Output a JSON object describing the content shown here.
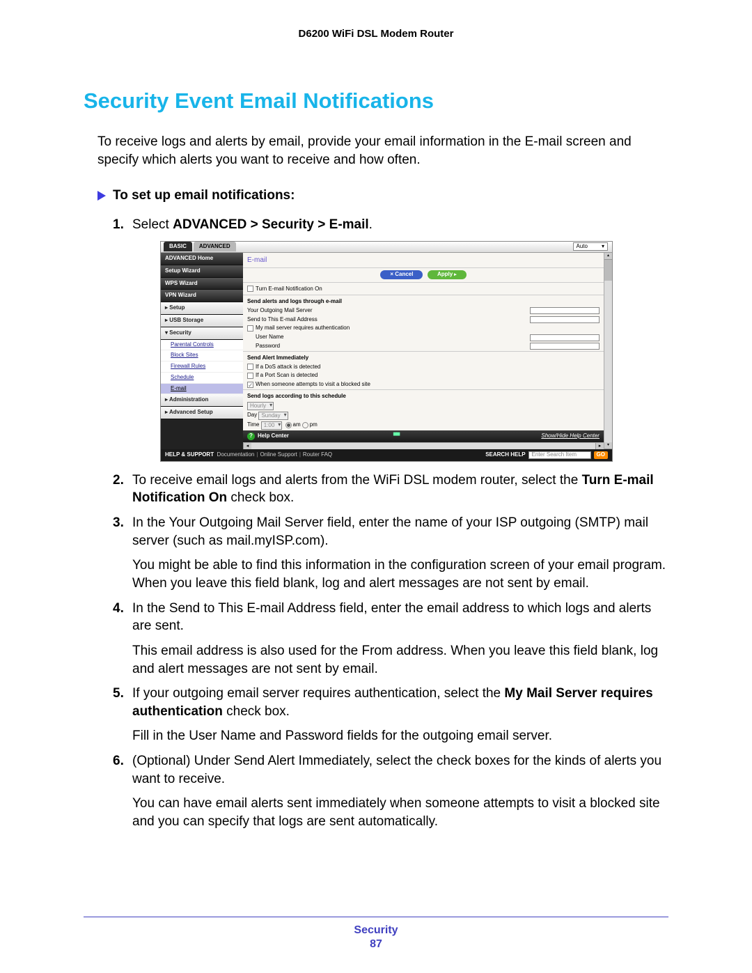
{
  "header": {
    "model": "D6200 WiFi DSL Modem Router"
  },
  "title": "Security Event Email Notifications",
  "intro": "To receive logs and alerts by email, provide your email information in the E-mail screen and specify which alerts you want to receive and how often.",
  "subhead": "To set up email notifications:",
  "steps": {
    "s1_prefix": "Select ",
    "s1_bold": "ADVANCED > Security > E-mail",
    "s1_suffix": ".",
    "s2a": "To receive email logs and alerts from the WiFi DSL modem router, select the ",
    "s2b": "Turn E-mail Notification On",
    "s2c": " check box.",
    "s3": "In the Your Outgoing Mail Server field, enter the name of your ISP outgoing (SMTP) mail server (such as mail.myISP.com).",
    "s3p": "You might be able to find this information in the configuration screen of your email program. When you leave this field blank, log and alert messages are not sent by email.",
    "s4": "In the Send to This E-mail Address field, enter the email address to which logs and alerts are sent.",
    "s4p": "This email address is also used for the From address. When you leave this field blank, log and alert messages are not sent by email.",
    "s5a": "If your outgoing email server requires authentication, select the ",
    "s5b": "My Mail Server requires authentication",
    "s5c": " check box.",
    "s5p": "Fill in the User Name and Password fields for the outgoing email server.",
    "s6": "(Optional) Under Send Alert Immediately, select the check boxes for the kinds of alerts you want to receive.",
    "s6p": "You can have email alerts sent immediately when someone attempts to visit a blocked site and you can specify that logs are sent automatically."
  },
  "shot": {
    "tabs": {
      "basic": "BASIC",
      "advanced": "ADVANCED",
      "auto": "Auto"
    },
    "sidebar": {
      "home": "ADVANCED Home",
      "setup_wizard": "Setup Wizard",
      "wps_wizard": "WPS Wizard",
      "vpn_wizard": "VPN Wizard",
      "setup": "▸ Setup",
      "usb": "▸ USB Storage",
      "security": "▾ Security",
      "sub": {
        "parental": "Parental Controls",
        "block_sites": "Block Sites",
        "firewall": "Firewall Rules",
        "schedule": "Schedule",
        "email": "E-mail"
      },
      "admin": "▸ Administration",
      "advsetup": "▸ Advanced Setup"
    },
    "content": {
      "title": "E-mail",
      "cancel": "Cancel",
      "apply": "Apply",
      "turn_on": "Turn E-mail Notification On",
      "send_alerts_h": "Send alerts and logs through e-mail",
      "outgoing": "Your Outgoing Mail Server",
      "sendto": "Send to This E-mail Address",
      "auth": "My mail server requires authentication",
      "username": "User Name",
      "password": "Password",
      "immediate_h": "Send Alert Immediately",
      "dos": "If a DoS attack is detected",
      "portscan": "If a Port Scan is detected",
      "blockedsite": "When someone attempts to visit a blocked site",
      "schedule_h": "Send logs according to this schedule",
      "hourly": "Hourly",
      "day_lbl": "Day",
      "day_val": "Sunday",
      "time_lbl": "Time",
      "time_val": "1:00",
      "am": "am",
      "pm": "pm",
      "helpcenter": "Help Center",
      "showhide": "Show/Hide Help Center"
    },
    "footer": {
      "help_support": "HELP & SUPPORT",
      "doc": "Documentation",
      "online": "Online Support",
      "faq": "Router FAQ",
      "search_help": "SEARCH HELP",
      "placeholder": "Enter Search Item",
      "go": "GO"
    }
  },
  "pagefooter": {
    "section": "Security",
    "page": "87"
  }
}
